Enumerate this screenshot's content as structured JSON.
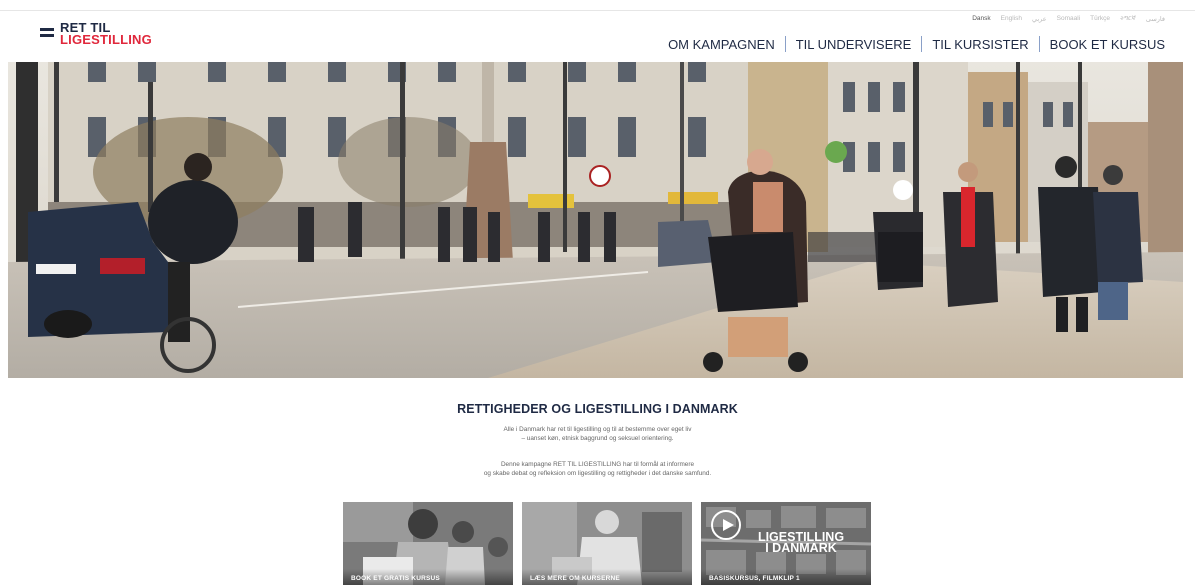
{
  "logo": {
    "line1": "RET TIL",
    "line2": "LIGESTILLING"
  },
  "languages": [
    "Dansk",
    "English",
    "عربي",
    "Somaali",
    "Türkçe",
    "ትግርኛ",
    "فارسی"
  ],
  "nav": {
    "items": [
      "OM KAMPAGNEN",
      "TIL UNDERVISERE",
      "TIL KURSISTER",
      "BOOK ET KURSUS"
    ]
  },
  "hero": {
    "description": "street-scene-photo"
  },
  "main": {
    "heading": "RETTIGHEDER OG LIGESTILLING I DANMARK",
    "para1_line1": "Alle i Danmark har ret til ligestilling og til at bestemme over eget liv",
    "para1_line2": "– uanset køn, etnisk baggrund og seksuel orientering.",
    "para2_line1": "Denne kampagne RET TIL LIGESTILLING har til formål at informere",
    "para2_line2": "og skabe debat og refleksion om ligestilling og rettigheder i det danske samfund."
  },
  "cards": [
    {
      "label": "BOOK ET GRATIS KURSUS"
    },
    {
      "label": "LÆS MERE OM KURSERNE"
    },
    {
      "label": "BASISKURSUS, FILMKLIP 1",
      "title_line1": "LIGESTILLING",
      "title_line2": "I DANMARK"
    }
  ],
  "colors": {
    "navy": "#1f2a44",
    "red": "#e0283c"
  }
}
